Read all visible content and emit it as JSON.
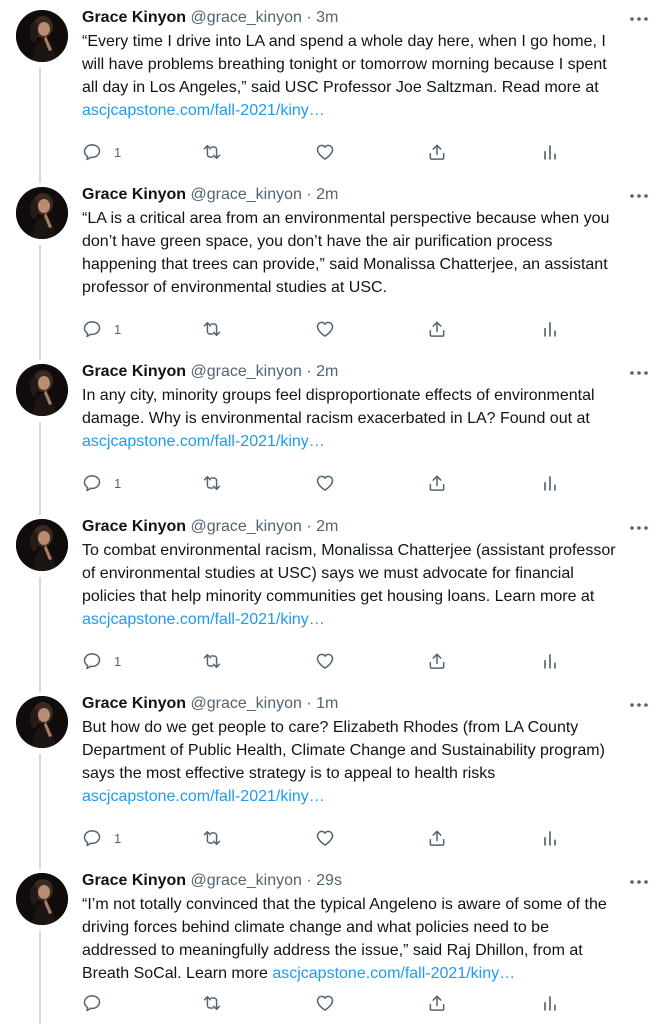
{
  "tweets": [
    {
      "name": "Grace Kinyon",
      "handle": "@grace_kinyon",
      "dot": "·",
      "time": "3m",
      "lines": [
        "“Every time I drive into LA and spend a whole day here, when I go home, I",
        "will have problems breathing tonight or tomorrow morning because I spent",
        "all day in Los Angeles,” said USC Professor Joe Saltzman. Read more at"
      ],
      "link_line_prefix": "",
      "link": "ascjcapstone.com/fall-2021/kiny…",
      "reply_count": "1"
    },
    {
      "name": "Grace Kinyon",
      "handle": "@grace_kinyon",
      "dot": "·",
      "time": "2m",
      "lines": [
        "“LA is a critical area from an environmental perspective because when you",
        "don’t have green space, you don’t have the air purification process",
        "happening that trees can provide,” said Monalissa Chatterjee, an assistant",
        "professor of environmental studies at USC."
      ],
      "link_line_prefix": "",
      "link": "",
      "reply_count": "1"
    },
    {
      "name": "Grace Kinyon",
      "handle": "@grace_kinyon",
      "dot": "·",
      "time": "2m",
      "lines": [
        "In any city, minority groups feel disproportionate effects of environmental",
        "damage. Why is environmental racism exacerbated in LA? Found out at"
      ],
      "link_line_prefix": "",
      "link": "ascjcapstone.com/fall-2021/kiny…",
      "reply_count": "1"
    },
    {
      "name": "Grace Kinyon",
      "handle": "@grace_kinyon",
      "dot": "·",
      "time": "2m",
      "lines": [
        "To combat environmental racism, Monalissa Chatterjee (assistant professor",
        "of environmental studies at USC) says we must advocate for financial",
        "policies that help minority communities get housing loans. Learn more at"
      ],
      "link_line_prefix": "",
      "link": "ascjcapstone.com/fall-2021/kiny…",
      "reply_count": "1"
    },
    {
      "name": "Grace Kinyon",
      "handle": "@grace_kinyon",
      "dot": "·",
      "time": "1m",
      "lines": [
        "But how do we get people to care? Elizabeth Rhodes (from LA County",
        "Department of Public Health, Climate Change and Sustainability program)",
        "says the most effective strategy is to appeal to health risks"
      ],
      "link_line_prefix": "",
      "link": "ascjcapstone.com/fall-2021/kiny…",
      "reply_count": "1"
    },
    {
      "name": "Grace Kinyon",
      "handle": "@grace_kinyon",
      "dot": "·",
      "time": "29s",
      "lines": [
        "“I’m not totally convinced that the typical Angeleno is aware of some of the",
        "driving forces behind climate change and what policies need to be",
        "addressed to meaningfully address the issue,” said Raj Dhillon, from at"
      ],
      "link_line_prefix": "Breath SoCal. Learn more ",
      "link": "ascjcapstone.com/fall-2021/kiny…",
      "reply_count": ""
    }
  ],
  "icons": {
    "reply": "reply-icon",
    "retweet": "retweet-icon",
    "like": "heart-icon",
    "share": "share-icon",
    "analytics": "analytics-icon",
    "more": "more-icon"
  },
  "colors": {
    "link": "#1d9bf0",
    "secondary_text": "#536471",
    "thread_line": "#cfd9de"
  }
}
